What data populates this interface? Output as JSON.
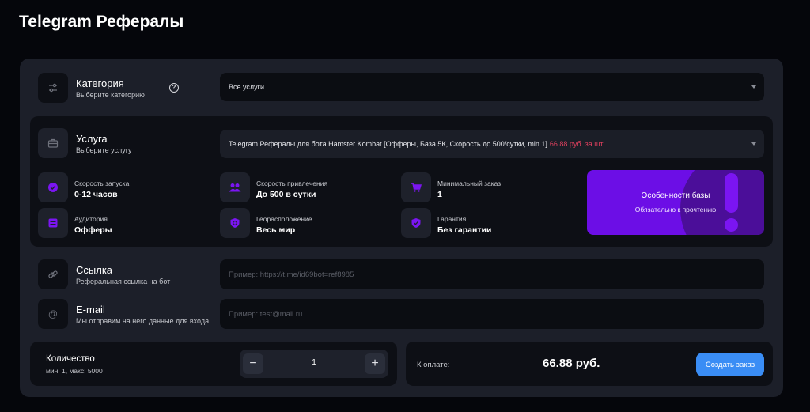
{
  "page": {
    "title": "Telegram Рефералы"
  },
  "category": {
    "title": "Категория",
    "subtitle": "Выберите категорию",
    "selected": "Все услуги"
  },
  "service": {
    "title": "Услуга",
    "subtitle": "Выберите услугу",
    "selected": "Telegram Рефералы для бота Hamster Kombat [Офферы, База 5К, Скорость до 500/сутки, min 1]",
    "price": "66.88 руб. за шт."
  },
  "features": [
    {
      "label": "Скорость запуска",
      "value": "0-12 часов",
      "icon": "check-badge-icon"
    },
    {
      "label": "Скорость привлечения",
      "value": "До 500 в сутки",
      "icon": "users-icon"
    },
    {
      "label": "Минимальный заказ",
      "value": "1",
      "icon": "cart-icon"
    },
    {
      "label": "Аудитория",
      "value": "Офферы",
      "icon": "audience-icon"
    },
    {
      "label": "Георасположение",
      "value": "Весь мир",
      "icon": "globe-shield-icon"
    },
    {
      "label": "Гарантия",
      "value": "Без гарантии",
      "icon": "shield-check-icon"
    }
  ],
  "promo": {
    "title": "Особенности базы",
    "subtitle": "Обязательно к прочтению"
  },
  "link": {
    "title": "Ссылка",
    "subtitle": "Реферальная ссылка на бот",
    "placeholder": "Пример: https://t.me/id69bot=ref8985"
  },
  "email": {
    "title": "E-mail",
    "subtitle": "Мы отправим на него данные для входа",
    "placeholder": "Пример: test@mail.ru"
  },
  "quantity": {
    "title": "Количество",
    "subtitle": "мин: 1, макс: 5000",
    "value": "1",
    "minus": "−",
    "plus": "+"
  },
  "payment": {
    "label": "К оплате:",
    "amount": "66.88 руб.",
    "button": "Создать заказ"
  },
  "colors": {
    "accent": "#7b15f2",
    "button": "#3a8df5",
    "price": "#e0405e"
  }
}
